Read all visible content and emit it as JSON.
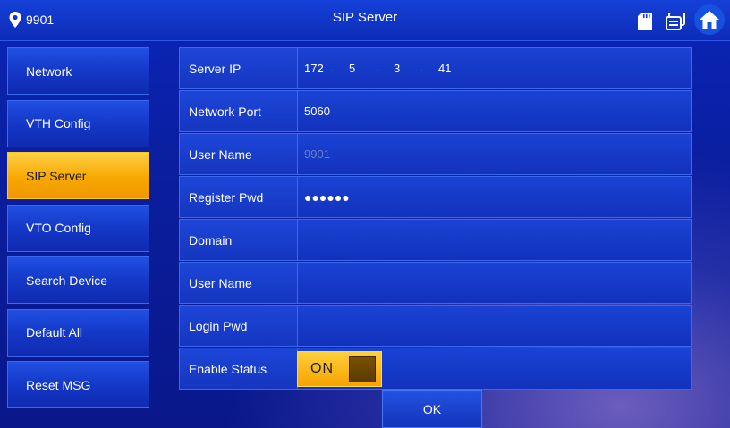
{
  "header": {
    "location_text": "9901",
    "title": "SIP Server"
  },
  "sidebar": {
    "items": [
      {
        "label": "Network"
      },
      {
        "label": "VTH Config"
      },
      {
        "label": "SIP Server",
        "active": true
      },
      {
        "label": "VTO Config"
      },
      {
        "label": "Search Device"
      },
      {
        "label": "Default All"
      },
      {
        "label": "Reset MSG"
      }
    ]
  },
  "form": {
    "server_ip": {
      "label": "Server IP",
      "octets": [
        "172",
        "5",
        "3",
        "41"
      ],
      "separator": "."
    },
    "network_port": {
      "label": "Network Port",
      "value": "5060"
    },
    "user_name": {
      "label": "User Name",
      "value": "9901"
    },
    "register_pwd": {
      "label": "Register Pwd",
      "value": "●●●●●●"
    },
    "domain": {
      "label": "Domain",
      "value": ""
    },
    "user_name_2": {
      "label": "User Name",
      "value": ""
    },
    "login_pwd": {
      "label": "Login Pwd",
      "value": ""
    },
    "enable_status": {
      "label": "Enable Status",
      "toggle_label": "ON",
      "enabled": true
    }
  },
  "footer": {
    "ok_label": "OK"
  },
  "colors": {
    "accent": "#f5a400",
    "panel_blue": "#1536c0",
    "header_blue": "#1540d8"
  },
  "icons": {
    "location": "location-pin-icon",
    "sd_card": "sd-card-icon",
    "message": "message-icon",
    "home": "home-icon"
  }
}
